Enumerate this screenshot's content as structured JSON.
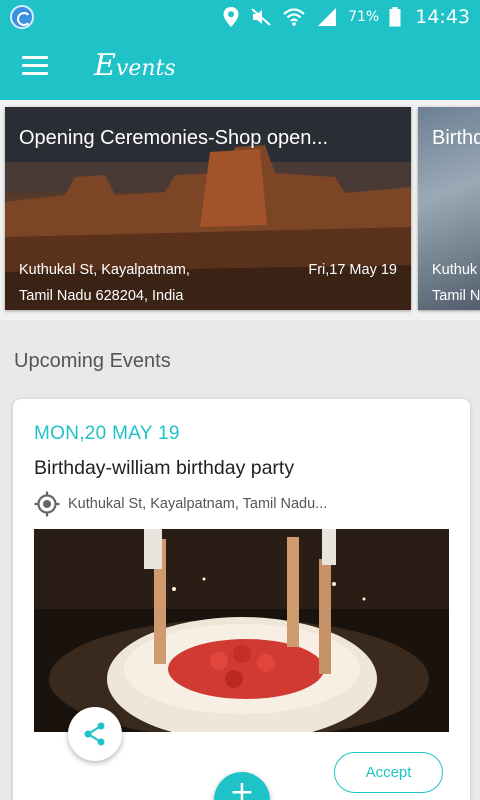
{
  "status_bar": {
    "battery": "71%",
    "time": "14:43"
  },
  "app_bar": {
    "logo_initial": "E",
    "logo_rest": "vents"
  },
  "featured": [
    {
      "title": "Opening Ceremonies-Shop open...",
      "address": "Kuthukal St, Kayalpatnam,\nTamil Nadu 628204, India",
      "date": "Fri,17 May 19"
    },
    {
      "title": "Birthd",
      "address": "Kuthuk\nTamil N"
    }
  ],
  "upcoming": {
    "heading": "Upcoming Events",
    "event": {
      "date": "MON,20 MAY 19",
      "title": "Birthday-william birthday party",
      "location": "Kuthukal St, Kayalpatnam, Tamil Nadu...",
      "accept_label": "Accept"
    }
  },
  "fab_label": "+",
  "colors": {
    "accent": "#1fc3c7"
  }
}
